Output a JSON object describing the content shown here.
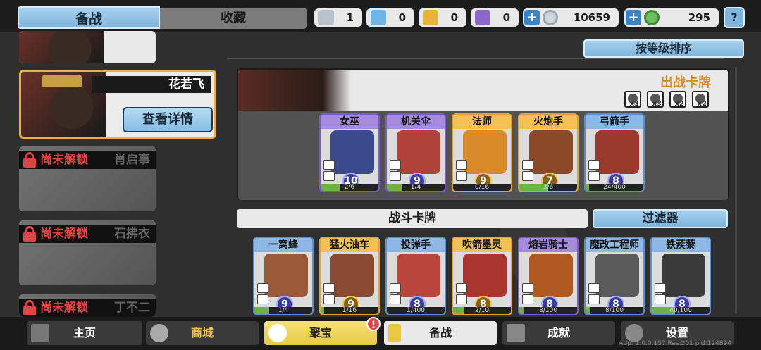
{
  "top": {
    "tab_main": "备战",
    "tab_collect": "收藏",
    "resources": [
      {
        "icon": "silver-crystal-icon",
        "value": "1",
        "color": "#b8c2cc"
      },
      {
        "icon": "blue-crystal-icon",
        "value": "0",
        "color": "#6fb4e6"
      },
      {
        "icon": "gold-crystal-icon",
        "value": "0",
        "color": "#e9b23a"
      },
      {
        "icon": "purple-crystal-icon",
        "value": "0",
        "color": "#8a67c9"
      }
    ],
    "coins": "10659",
    "jade": "295",
    "help": "?"
  },
  "heroes": [
    {
      "name": "花若飞",
      "detail_button": "查看详情",
      "selected": true
    },
    {
      "lock_text": "尚未解锁",
      "name": "肖启事"
    },
    {
      "lock_text": "尚未解锁",
      "name": "石拂衣"
    },
    {
      "lock_text": "尚未解锁",
      "name": "丁不二"
    }
  ],
  "sort_button": "按等级排序",
  "deck": {
    "title": "出战卡牌",
    "skills": [
      {
        "icon": "sword-icon",
        "count": "x3"
      },
      {
        "icon": "helmet-icon",
        "count": "x3"
      },
      {
        "icon": "skull-icon",
        "count": "x2"
      },
      {
        "icon": "shield-icon",
        "count": "x2"
      }
    ],
    "cards": [
      {
        "name": "女巫",
        "level": "10",
        "progress": "2/6",
        "progress_fraction": 0.33,
        "rarity": "purple",
        "art_color": "#3b4a8a"
      },
      {
        "name": "机关伞",
        "level": "9",
        "progress": "1/4",
        "progress_fraction": 0.25,
        "rarity": "purple",
        "art_color": "#b0423a"
      },
      {
        "name": "法师",
        "level": "9",
        "progress": "0/16",
        "progress_fraction": 0.0,
        "rarity": "gold",
        "art_color": "#d8892a"
      },
      {
        "name": "火炮手",
        "level": "7",
        "progress": "3/6",
        "progress_fraction": 0.5,
        "rarity": "gold",
        "art_color": "#8a4a2a"
      },
      {
        "name": "弓箭手",
        "level": "8",
        "progress": "24/400",
        "progress_fraction": 0.06,
        "rarity": "blue",
        "art_color": "#9a3a2e"
      }
    ]
  },
  "combat": {
    "title": "战斗卡牌",
    "filter_button": "过滤器",
    "cards": [
      {
        "name": "一窝蜂",
        "level": "9",
        "progress": "1/4",
        "progress_fraction": 0.25,
        "rarity": "blue",
        "art_color": "#9a5a3a"
      },
      {
        "name": "猛火油车",
        "level": "9",
        "progress": "1/16",
        "progress_fraction": 0.06,
        "rarity": "gold",
        "art_color": "#8a4a32"
      },
      {
        "name": "投弹手",
        "level": "8",
        "progress": "1/400",
        "progress_fraction": 0.0,
        "rarity": "blue",
        "art_color": "#b8463a"
      },
      {
        "name": "吹箭墨灵",
        "level": "8",
        "progress": "2/10",
        "progress_fraction": 0.2,
        "rarity": "gold",
        "art_color": "#a8362e"
      },
      {
        "name": "熔岩骑士",
        "level": "8",
        "progress": "8/100",
        "progress_fraction": 0.08,
        "rarity": "purple",
        "art_color": "#b05a22"
      },
      {
        "name": "魔改工程师",
        "level": "8",
        "progress": "8/100",
        "progress_fraction": 0.08,
        "rarity": "blue",
        "art_color": "#5a5a5a"
      },
      {
        "name": "铁蒺藜",
        "level": "8",
        "progress": "40/100",
        "progress_fraction": 0.4,
        "rarity": "blue",
        "art_color": "#3a3a3a"
      }
    ]
  },
  "nav": {
    "home": "主页",
    "shop": "商城",
    "treasure": "聚宝",
    "treasure_badge": "!",
    "battle": "备战",
    "achievement": "成就",
    "settings": "设置"
  },
  "version": "App: 1.0.0.157 Res:201 pid:124894"
}
